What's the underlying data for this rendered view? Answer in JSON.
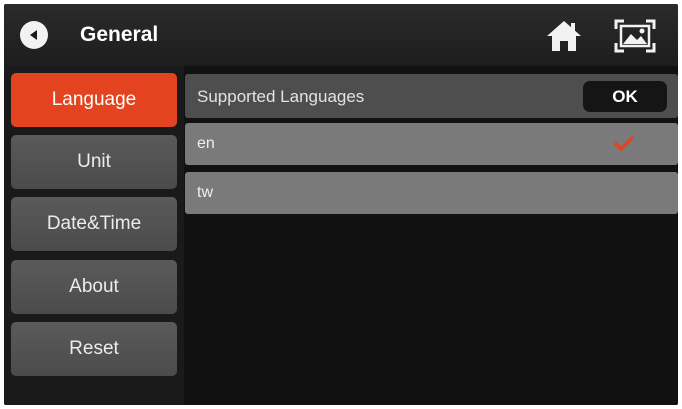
{
  "header": {
    "title": "General",
    "back_icon": "back-arrow-icon",
    "home_icon": "home-icon",
    "screenshot_icon": "screenshot-icon"
  },
  "sidebar": {
    "items": [
      {
        "label": "Language",
        "active": true
      },
      {
        "label": "Unit",
        "active": false
      },
      {
        "label": "Date&Time",
        "active": false
      },
      {
        "label": "About",
        "active": false
      },
      {
        "label": "Reset",
        "active": false
      }
    ]
  },
  "main": {
    "section_label": "Supported Languages",
    "ok_label": "OK",
    "languages": [
      {
        "code": "en",
        "selected": true
      },
      {
        "code": "tw",
        "selected": false
      }
    ]
  },
  "colors": {
    "accent": "#e44320",
    "check": "#e44320"
  }
}
